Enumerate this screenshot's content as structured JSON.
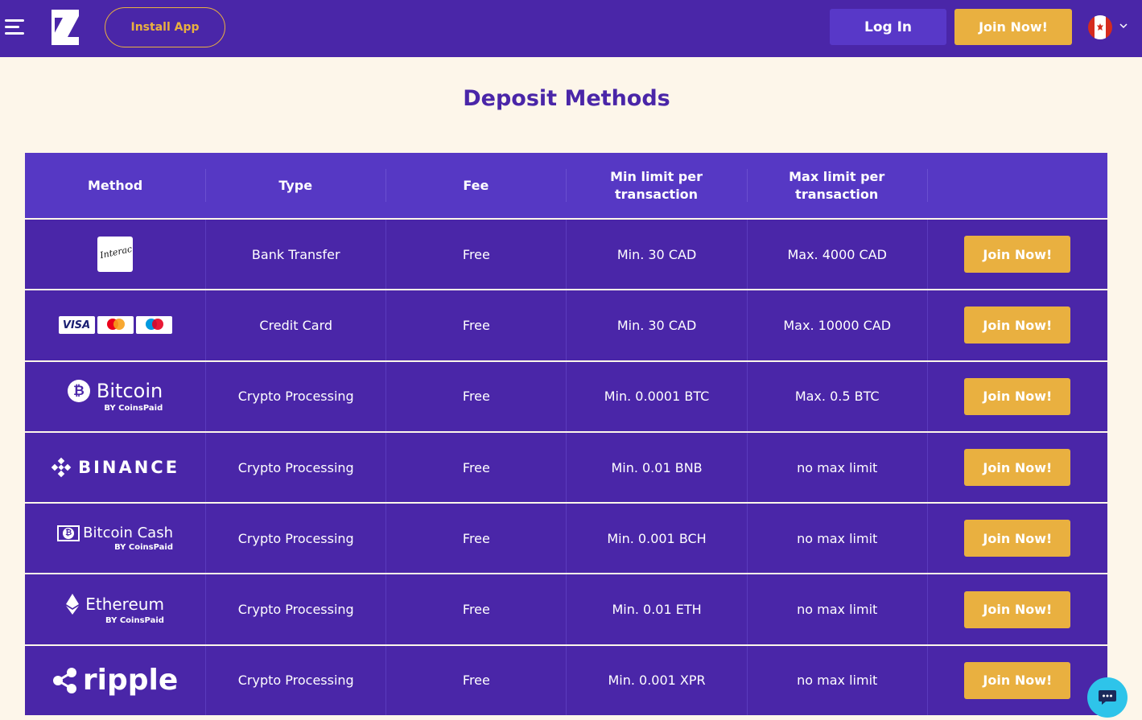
{
  "header": {
    "install_label": "Install App",
    "login_label": "Log In",
    "join_label": "Join Now!",
    "language": "canada-flag-icon"
  },
  "page_title": "Deposit Methods",
  "table": {
    "columns": [
      "Method",
      "Type",
      "Fee",
      "Min limit per transaction",
      "Max limit per transaction",
      ""
    ],
    "rows": [
      {
        "method": "Interac",
        "logo_text": "Interac",
        "type": "Bank Transfer",
        "fee": "Free",
        "min": "Min. 30 CAD",
        "max": "Max. 4000 CAD",
        "cta": "Join Now!"
      },
      {
        "method": "Visa / Mastercard / Maestro",
        "logo_text": "VISA",
        "type": "Credit Card",
        "fee": "Free",
        "min": "Min. 30 CAD",
        "max": "Max. 10000 CAD",
        "cta": "Join Now!"
      },
      {
        "method": "Bitcoin",
        "logo_text": "Bitcoin",
        "by": "BY CoinsPaid",
        "type": "Crypto Processing",
        "fee": "Free",
        "min": "Min. 0.0001 BTC",
        "max": "Max. 0.5 BTC",
        "cta": "Join Now!"
      },
      {
        "method": "Binance",
        "logo_text": "BINANCE",
        "type": "Crypto Processing",
        "fee": "Free",
        "min": "Min. 0.01 BNB",
        "max": "no max limit",
        "cta": "Join Now!"
      },
      {
        "method": "Bitcoin Cash",
        "logo_text": "Bitcoin Cash",
        "by": "BY CoinsPaid",
        "type": "Crypto Processing",
        "fee": "Free",
        "min": "Min. 0.001 BCH",
        "max": "no max limit",
        "cta": "Join Now!"
      },
      {
        "method": "Ethereum",
        "logo_text": "Ethereum",
        "by": "BY CoinsPaid",
        "type": "Crypto Processing",
        "fee": "Free",
        "min": "Min. 0.01 ETH",
        "max": "no max limit",
        "cta": "Join Now!"
      },
      {
        "method": "Ripple",
        "logo_text": "ripple",
        "type": "Crypto Processing",
        "fee": "Free",
        "min": "Min. 0.001 XPR",
        "max": "no max limit",
        "cta": "Join Now!"
      }
    ]
  },
  "colors": {
    "header_bg": "#4a26a8",
    "page_bg": "#fdf6ea",
    "accent": "#e9b040",
    "table_header_bg": "#5638c4",
    "row_bg": "#4a26a8",
    "chat_bg": "#2ec4ea"
  }
}
